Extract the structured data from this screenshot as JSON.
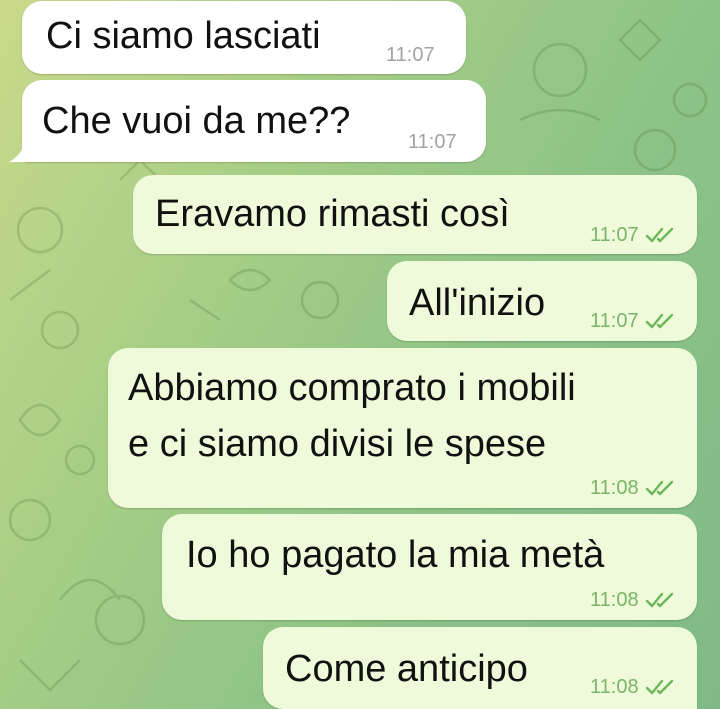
{
  "chat": {
    "messages": [
      {
        "direction": "incoming",
        "text": "Ci siamo lasciati",
        "time": "11:07"
      },
      {
        "direction": "incoming",
        "text": "Che vuoi da me??",
        "time": "11:07"
      },
      {
        "direction": "outgoing",
        "text": "Eravamo rimasti così",
        "time": "11:07",
        "status_icon": "double-check-icon"
      },
      {
        "direction": "outgoing",
        "text": "All'inizio",
        "time": "11:07",
        "status_icon": "double-check-icon"
      },
      {
        "direction": "outgoing",
        "lines": [
          "Abbiamo comprato i mobili",
          "e ci siamo divisi le spese"
        ],
        "time": "11:08",
        "status_icon": "double-check-icon"
      },
      {
        "direction": "outgoing",
        "text": "Io ho pagato la mia metà",
        "time": "11:08",
        "status_icon": "double-check-icon"
      },
      {
        "direction": "outgoing",
        "text": "Come anticipo",
        "time": "11:08",
        "status_icon": "double-check-icon"
      }
    ]
  },
  "colors": {
    "incoming_bubble": "#ffffff",
    "outgoing_bubble": "#eefad9",
    "check_green": "#6db65b"
  }
}
